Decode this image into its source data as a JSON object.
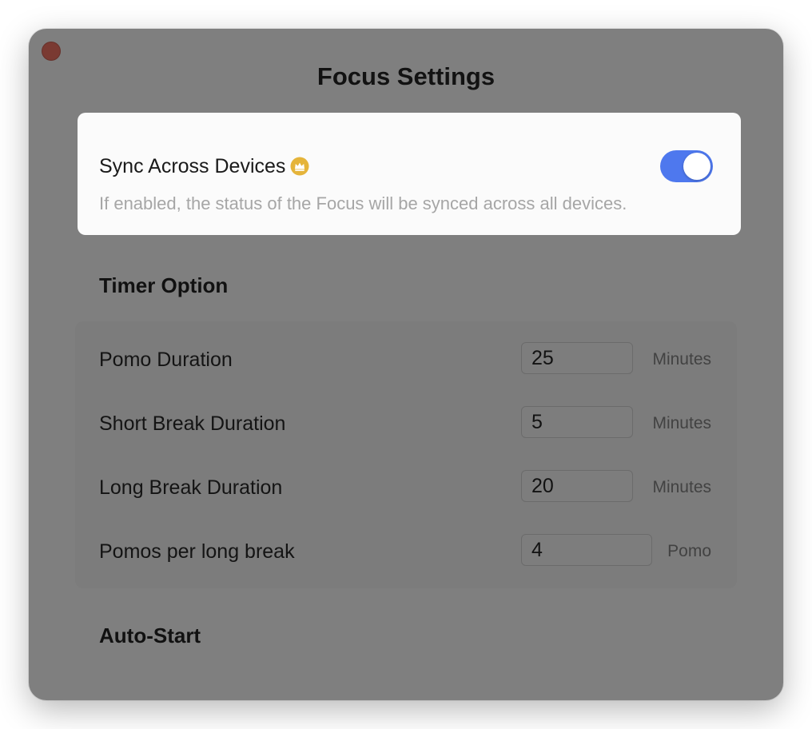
{
  "window": {
    "title": "Focus Settings"
  },
  "sync": {
    "title": "Sync Across Devices",
    "badge_icon": "crown-icon",
    "badge_color": "#e5b43a",
    "description": "If enabled, the status of the Focus will be synced across all devices.",
    "enabled": true,
    "toggle_color": "#4e78ee"
  },
  "timer": {
    "heading": "Timer Option",
    "rows": [
      {
        "label": "Pomo Duration",
        "value": "25",
        "unit": "Minutes"
      },
      {
        "label": "Short Break Duration",
        "value": "5",
        "unit": "Minutes"
      },
      {
        "label": "Long Break Duration",
        "value": "20",
        "unit": "Minutes"
      },
      {
        "label": "Pomos per long break",
        "value": "4",
        "unit": "Pomo"
      }
    ]
  },
  "auto_start": {
    "heading": "Auto-Start"
  }
}
